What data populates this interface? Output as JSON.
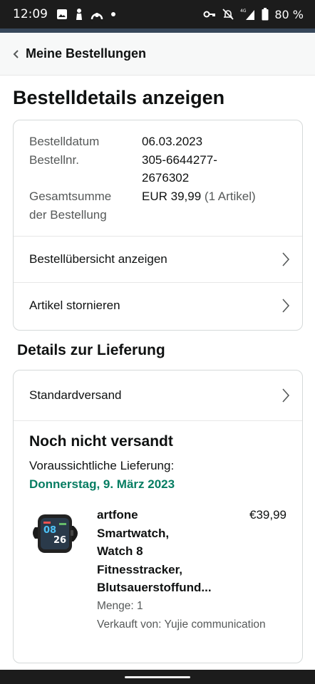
{
  "status_bar": {
    "time": "12:09",
    "battery": "80 %",
    "network": "4G",
    "icons_left": [
      "gallery-icon",
      "person-icon",
      "app-icon",
      "dot-icon"
    ],
    "icons_right": [
      "key-icon",
      "bell-muted-icon",
      "signal-icon",
      "battery-icon"
    ]
  },
  "header": {
    "back_label": "Meine Bestellungen"
  },
  "page_title": "Bestelldetails anzeigen",
  "order_summary": {
    "date_label": "Bestelldatum",
    "date_value": "06.03.2023",
    "number_label": "Bestellnr.",
    "number_value_line1": "305-6644277-",
    "number_value_line2": "2676302",
    "total_label_line1": "Gesamtsumme",
    "total_label_line2": "der Bestellung",
    "total_value": "EUR 39,99",
    "total_items": "(1 Artikel)"
  },
  "links": {
    "overview": "Bestellübersicht anzeigen",
    "cancel": "Artikel stornieren"
  },
  "delivery": {
    "section_title": "Details zur Lieferung",
    "shipping_method": "Standardversand",
    "status": "Noch nicht versandt",
    "expected_label": "Voraussichtliche Lieferung:",
    "expected_date": "Donnerstag, 9. März 2023",
    "date_color": "#067d62"
  },
  "product": {
    "name_lines": [
      "artfone",
      "Smartwatch,",
      "Watch 8",
      "Fitnesstracker,",
      "Blutsauerstoffund..."
    ],
    "price": "€39,99",
    "quantity": "Menge: 1",
    "seller": "Verkauft von: Yujie communication",
    "watch_time_h": "08",
    "watch_time_m": "26"
  }
}
